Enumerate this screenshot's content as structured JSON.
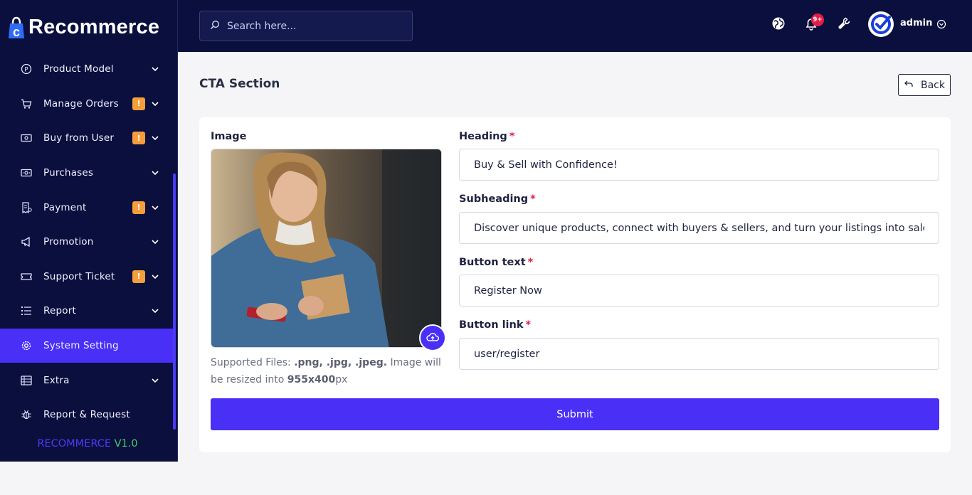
{
  "brand": {
    "name": "Recommerce"
  },
  "sidebar": {
    "items": [
      {
        "label": "Product Model",
        "icon": "product-icon",
        "badge": "",
        "chevron": true
      },
      {
        "label": "Manage Orders",
        "icon": "cart-icon",
        "badge": "!",
        "chevron": true
      },
      {
        "label": "Buy from User",
        "icon": "cash-icon",
        "badge": "!",
        "chevron": true
      },
      {
        "label": "Purchases",
        "icon": "purchase-icon",
        "badge": "",
        "chevron": true
      },
      {
        "label": "Payment",
        "icon": "receipt-icon",
        "badge": "!",
        "chevron": true
      },
      {
        "label": "Promotion",
        "icon": "megaphone-icon",
        "badge": "",
        "chevron": true
      },
      {
        "label": "Support Ticket",
        "icon": "ticket-icon",
        "badge": "!",
        "chevron": true
      },
      {
        "label": "Report",
        "icon": "list-icon",
        "badge": "",
        "chevron": true
      },
      {
        "label": "System Setting",
        "icon": "gear-icon",
        "badge": "",
        "chevron": false,
        "active": true
      },
      {
        "label": "Extra",
        "icon": "extra-icon",
        "badge": "",
        "chevron": true
      },
      {
        "label": "Report & Request",
        "icon": "bug-icon",
        "badge": "",
        "chevron": false
      }
    ],
    "version_name": "RECOMMERCE",
    "version_number": "V1.0"
  },
  "header": {
    "search_placeholder": "Search here...",
    "notification_count": "9+",
    "user_name": "admin"
  },
  "page": {
    "title": "CTA Section",
    "back_label": "Back"
  },
  "form": {
    "image_label": "Image",
    "help_prefix": "Supported Files: ",
    "help_types": ".png, .jpg, .jpeg.",
    "help_middle": " Image will be resized into ",
    "help_size": "955x400",
    "help_unit": "px",
    "heading_label": "Heading",
    "heading_value": "Buy & Sell with Confidence!",
    "subheading_label": "Subheading",
    "subheading_value": "Discover unique products, connect with buyers & sellers, and turn your listings into sales—fast and secure!",
    "button_text_label": "Button text",
    "button_text_value": "Register Now",
    "button_link_label": "Button link",
    "button_link_value": "user/register",
    "required_mark": "*",
    "submit_label": "Submit"
  },
  "colors": {
    "sidebar_bg": "#0b0f3d",
    "accent": "#4a2ff7",
    "badge": "#f59e3b",
    "required": "#e11d48",
    "version_number": "#3ecf6a"
  }
}
